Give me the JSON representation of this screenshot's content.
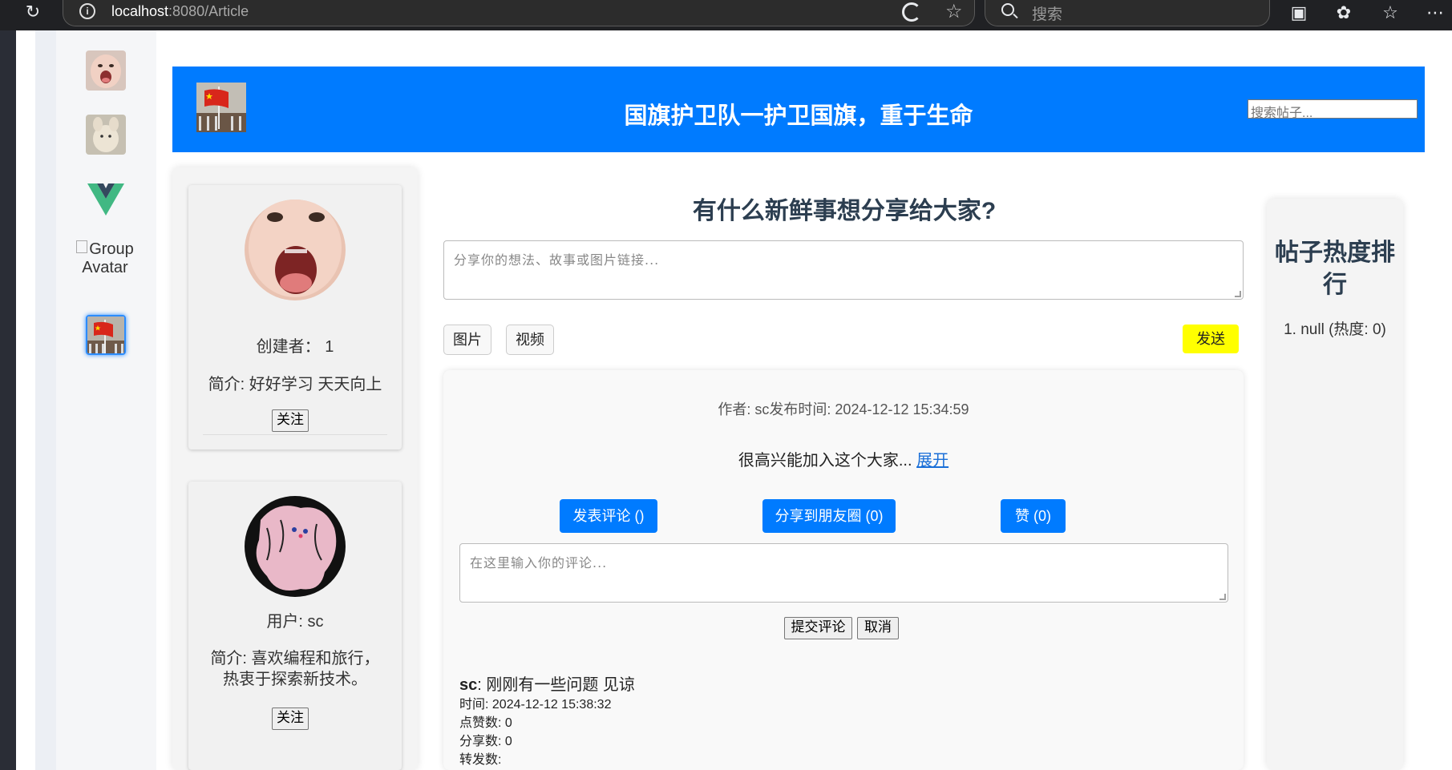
{
  "browser": {
    "url_host": "localhost",
    "url_path": ":8080/Article",
    "search_placeholder": "搜索"
  },
  "groups": {
    "broken_alt": "Group Avatar"
  },
  "header": {
    "title": "国旗护卫队一护卫国旗，重于生命",
    "search_placeholder": "搜索帖子..."
  },
  "users": [
    {
      "role_line": "创建者： 1",
      "bio": "简介: 好好学习 天天向上",
      "follow_label": "关注"
    },
    {
      "role_line": "用户: sc",
      "bio_line1": "简介: 喜欢编程和旅行，",
      "bio_line2": "热衷于探索新技术。",
      "follow_label": "关注"
    }
  ],
  "compose": {
    "title": "有什么新鲜事想分享给大家?",
    "placeholder": "分享你的想法、故事或图片链接...",
    "image_label": "图片",
    "video_label": "视频",
    "send_label": "发送"
  },
  "post": {
    "meta": "作者: sc发布时间: 2024-12-12 15:34:59",
    "content": "很高兴能加入这个大家...",
    "expand_label": "展开",
    "comment_btn": "发表评论 ()",
    "share_btn": "分享到朋友圈 (0)",
    "like_btn": "赞 (0)",
    "comment_placeholder": "在这里输入你的评论...",
    "submit_label": "提交评论",
    "cancel_label": "取消"
  },
  "comment": {
    "author": "sc",
    "text": ": 刚刚有一些问题 见谅",
    "time": "时间: 2024-12-12 15:38:32",
    "likes": "点赞数: 0",
    "shares": "分享数: 0",
    "forwards": "转发数:"
  },
  "ranking": {
    "title": "帖子热度排行",
    "items": [
      "1. null (热度: 0)"
    ]
  },
  "colors": {
    "header_bg": "#007bff",
    "primary_button": "#007bff",
    "send_button": "#ffff00"
  }
}
